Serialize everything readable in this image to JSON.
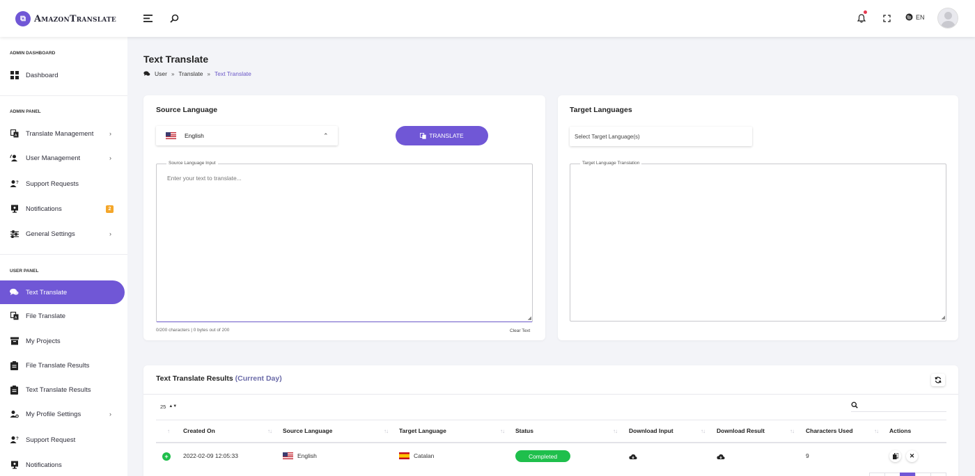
{
  "app": {
    "logo_letter": "⧉",
    "name": "AmazonTranslate"
  },
  "topbar": {
    "menu_icon": "hamburger-icon",
    "search_icon": "search-icon",
    "bell_icon": "bell-icon",
    "fullscreen_icon": "fullscreen-icon",
    "language": "EN"
  },
  "sidebar": {
    "admin_dashboard_title": "ADMIN DASHBOARD",
    "dashboard": "Dashboard",
    "admin_panel_title": "ADMIN PANEL",
    "admin_items": [
      {
        "label": "Translate Management"
      },
      {
        "label": "User Management"
      },
      {
        "label": "Support Requests"
      },
      {
        "label": "Notifications",
        "badge": "2"
      },
      {
        "label": "General Settings"
      }
    ],
    "user_panel_title": "USER PANEL",
    "user_items": [
      {
        "label": "Text Translate"
      },
      {
        "label": "File Translate"
      },
      {
        "label": "My Projects"
      },
      {
        "label": "File Translate Results"
      },
      {
        "label": "Text Translate Results"
      },
      {
        "label": "My Profile Settings"
      },
      {
        "label": "Support Request"
      },
      {
        "label": "Notifications"
      }
    ]
  },
  "page": {
    "title": "Text Translate",
    "breadcrumb": [
      "User",
      "Translate",
      "Text Translate"
    ]
  },
  "source": {
    "title": "Source Language",
    "selected_language": "English",
    "translate_button": "TRANSLATE",
    "input_legend": "Source Language Input",
    "input_placeholder": "Enter your text to translate...",
    "counter": "0/200 characters | 0 bytes out of 200",
    "clear_text": "Clear Text"
  },
  "target": {
    "title": "Target Languages",
    "select_placeholder": "Select Target Language(s)",
    "output_legend": "Target Language Translation"
  },
  "results": {
    "title": "Text Translate Results",
    "title_suffix": "(Current Day)",
    "page_size": "25",
    "columns": [
      "Created On",
      "Source Language",
      "Target Language",
      "Status",
      "Download Input",
      "Download Result",
      "Characters Used",
      "Actions"
    ],
    "rows": [
      {
        "created_on": "2022-02-09 12:05:33",
        "source_language": "English",
        "target_language": "Catalan",
        "status": "Completed",
        "characters_used": "9"
      }
    ]
  },
  "colors": {
    "accent": "#7057d6",
    "status_completed": "#1fbf4c",
    "badge": "#f4a62a"
  }
}
